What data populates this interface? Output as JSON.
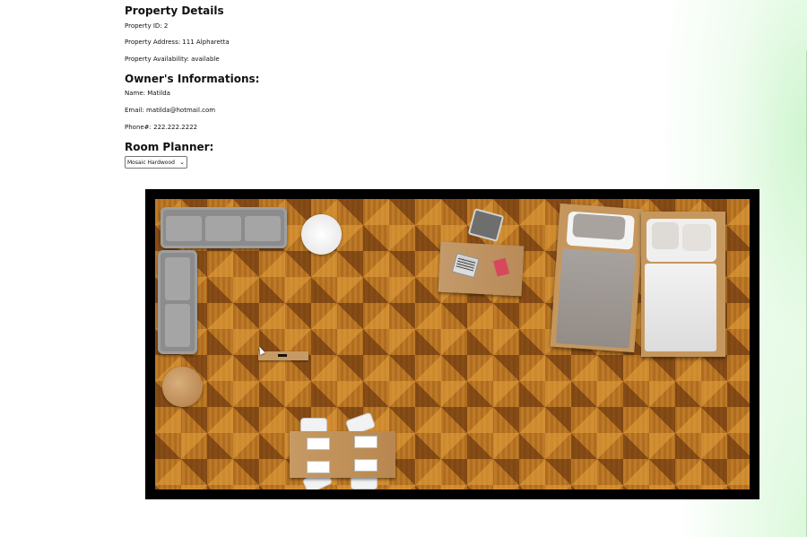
{
  "property": {
    "heading": "Property Details",
    "id_line": "Property ID: 2",
    "address_line": "Property Address: 111 Alpharetta",
    "availability_line": "Property Availability: available"
  },
  "owner": {
    "heading": "Owner's Informations:",
    "name_line": "Name: Matilda",
    "email_line": "Email: matilda@hotmail.com",
    "phone_line": "Phone#: 222.222.2222"
  },
  "planner": {
    "heading": "Room Planner:",
    "floor_select": {
      "selected": "Mosaic Hardwood",
      "chevron_icon": "chevron-down-icon"
    },
    "floor_pattern": "mosaic-hardwood",
    "colors": {
      "border": "#000000",
      "wood_light": "#e0a050",
      "wood_dark": "#5a280a",
      "furniture_gray": "#8c8c8c"
    },
    "furniture": [
      "sectional-sofa",
      "round-side-table",
      "desk-with-laptop",
      "office-chair",
      "bed-gray",
      "bed-white",
      "tv-bench",
      "round-wood-table",
      "dining-table",
      "dining-chairs"
    ]
  }
}
